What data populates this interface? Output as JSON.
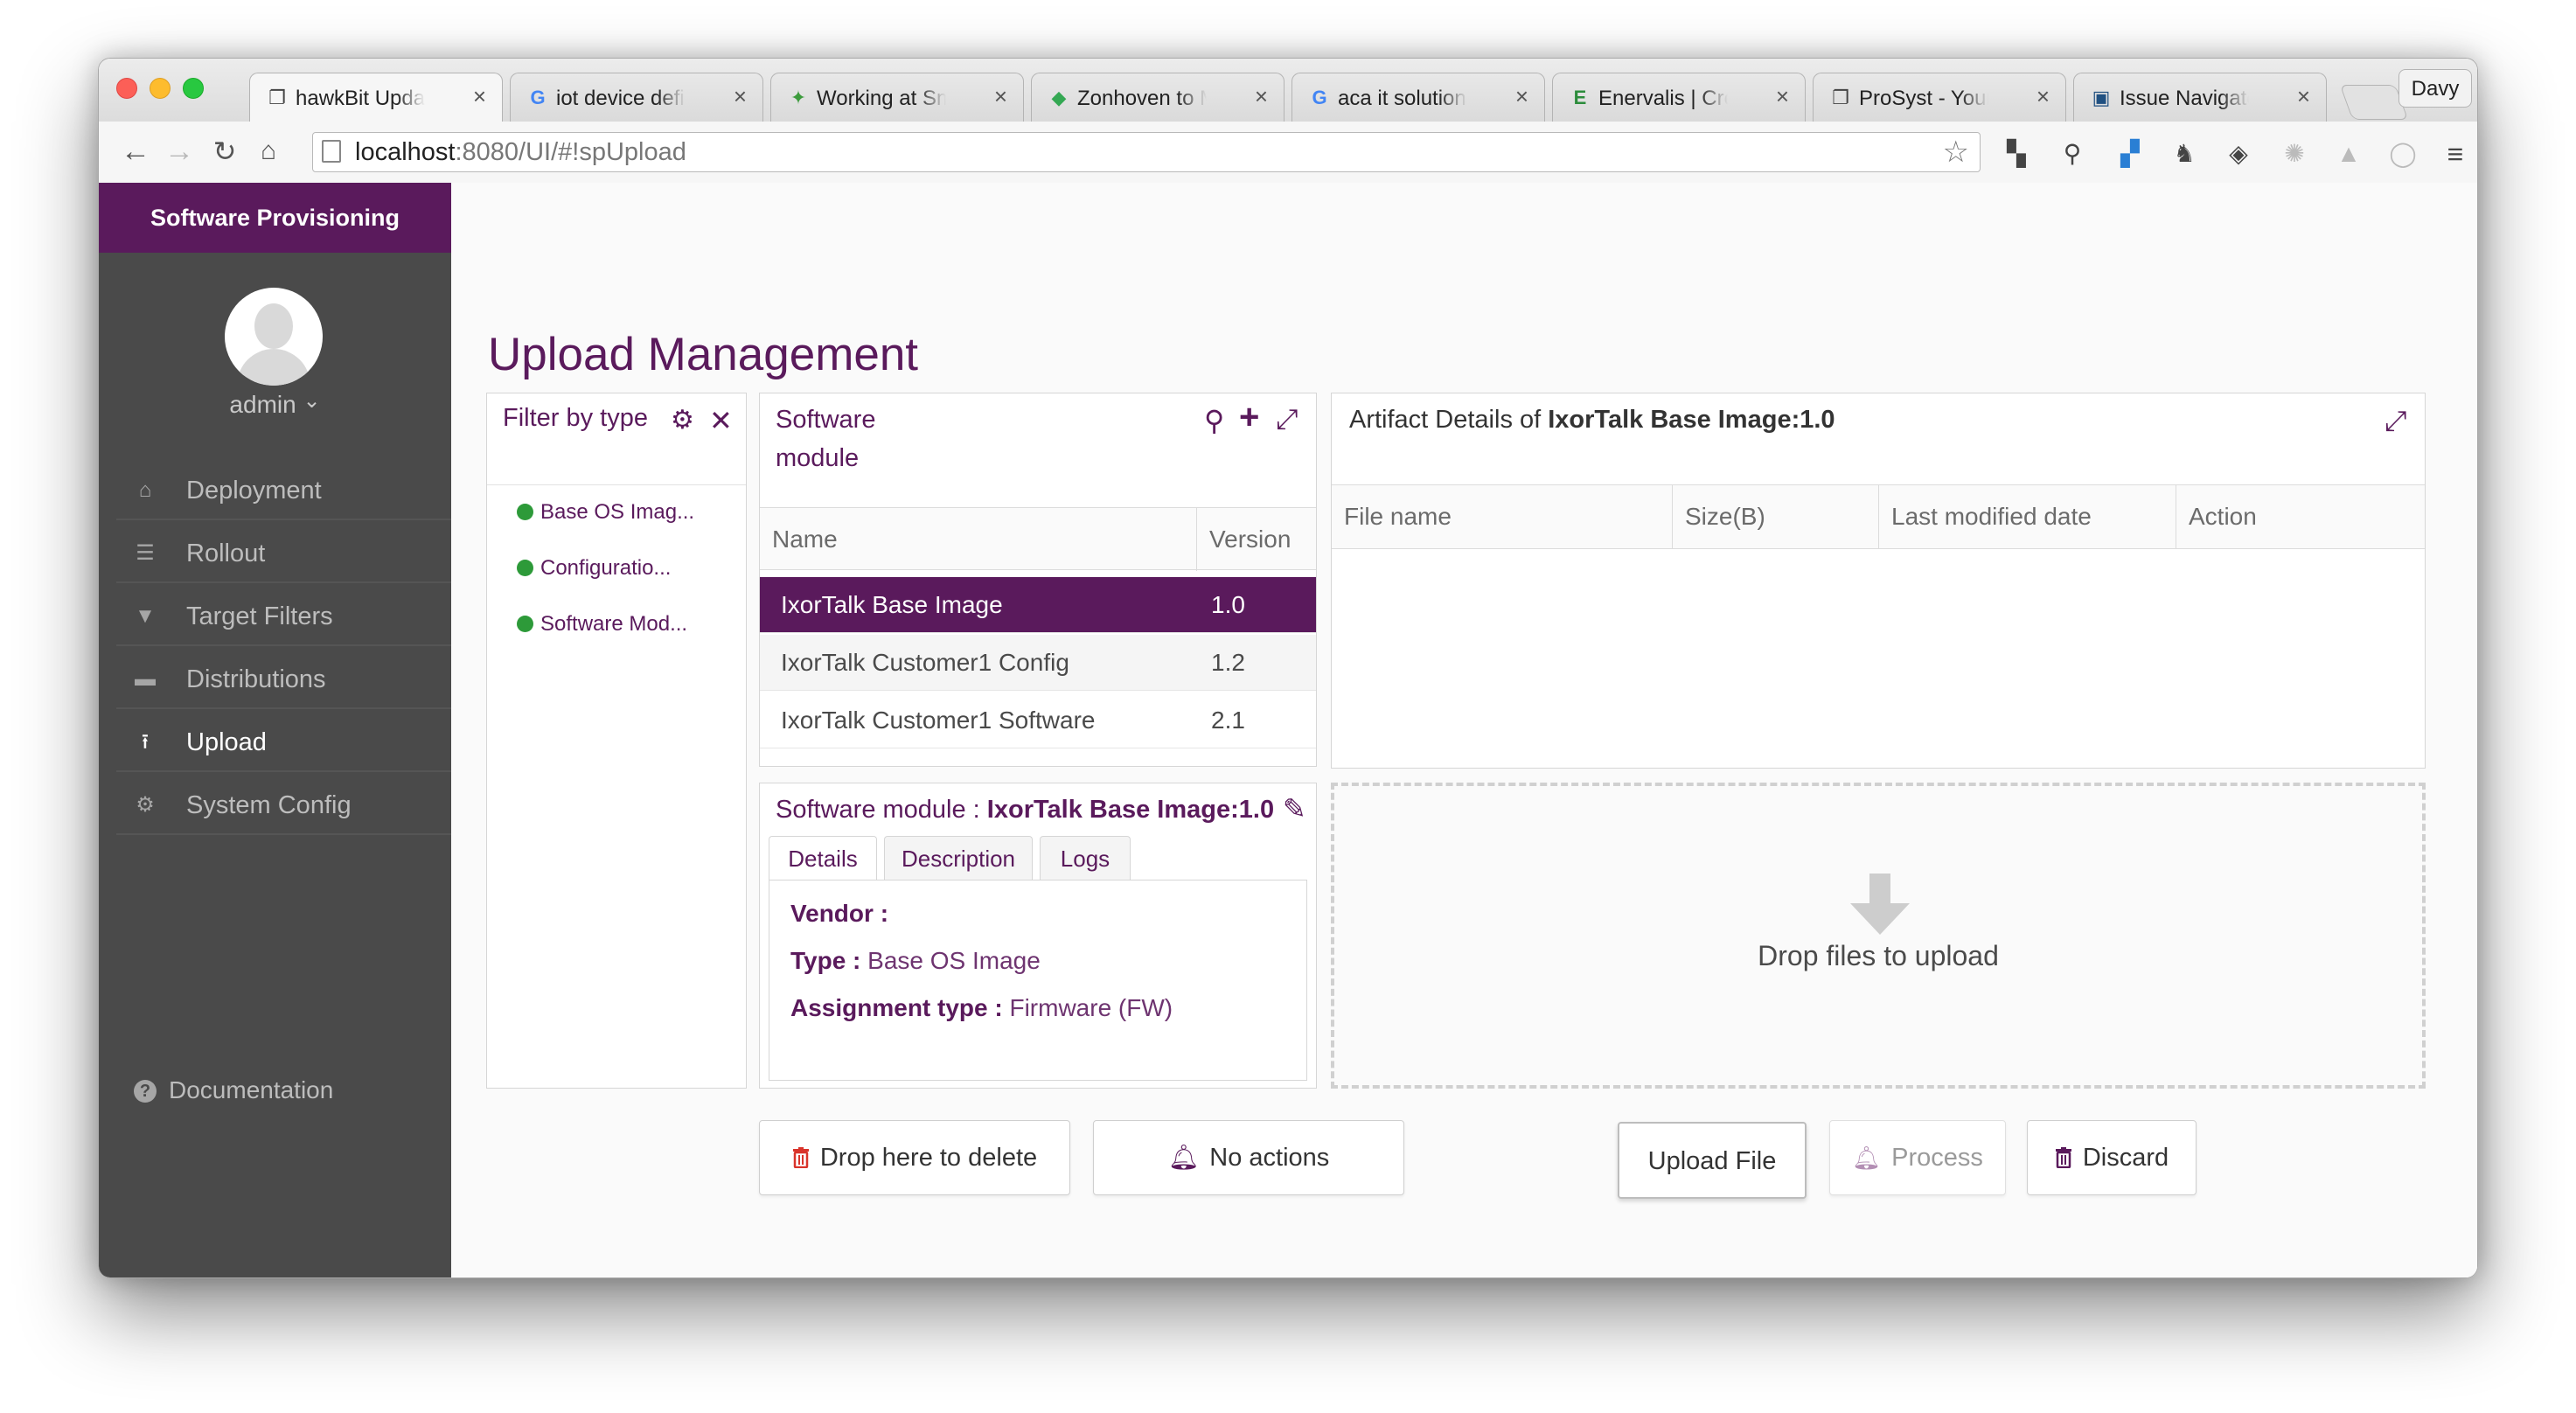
{
  "browser": {
    "tabs": [
      {
        "label": "hawkBit Update S",
        "fav": "❐",
        "color": "#444"
      },
      {
        "label": "iot device definitio",
        "fav": "G",
        "color": "#4285f4"
      },
      {
        "label": "Working at Smartic",
        "fav": "✦",
        "color": "#3c9b3c"
      },
      {
        "label": "Zonhoven to Muns",
        "fav": "◆",
        "color": "#34a853"
      },
      {
        "label": "aca it solutions sn",
        "fav": "G",
        "color": "#4285f4"
      },
      {
        "label": "Enervalis | Creating",
        "fav": "E",
        "color": "#2c8c3c"
      },
      {
        "label": "ProSyst - Your Par",
        "fav": "❐",
        "color": "#444"
      },
      {
        "label": "Issue Navigator - ",
        "fav": "▣",
        "color": "#205081"
      }
    ],
    "tab_close": "×",
    "profile": "Davy",
    "url_host": "localhost",
    "url_rest": ":8080/UI/#!spUpload"
  },
  "sidebar": {
    "header": "Software Provisioning",
    "user": "admin",
    "user_chevron": "⌄",
    "items": [
      {
        "label": "Deployment",
        "icon": "home-icon"
      },
      {
        "label": "Rollout",
        "icon": "list-icon"
      },
      {
        "label": "Target Filters",
        "icon": "filter-icon"
      },
      {
        "label": "Distributions",
        "icon": "briefcase-icon"
      },
      {
        "label": "Upload",
        "icon": "upload-icon"
      },
      {
        "label": "System Config",
        "icon": "gear-icon"
      }
    ],
    "documentation": "Documentation"
  },
  "page": {
    "title": "Upload Management"
  },
  "filter": {
    "title": "Filter by type",
    "types": [
      "Base OS Imag...",
      "Configuratio...",
      "Software Mod..."
    ]
  },
  "software_module": {
    "title_line1": "Software",
    "title_line2": "module",
    "columns": [
      "Name",
      "Version"
    ],
    "rows": [
      {
        "name": "IxorTalk Base Image",
        "version": "1.0"
      },
      {
        "name": "IxorTalk Customer1 Config",
        "version": "1.2"
      },
      {
        "name": "IxorTalk Customer1 Software",
        "version": "2.1"
      }
    ],
    "selected_index": 0
  },
  "details": {
    "heading_prefix": "Software module : ",
    "heading_name": "IxorTalk Base Image:1.0",
    "tabs": [
      "Details",
      "Description",
      "Logs"
    ],
    "vendor_label": "Vendor :",
    "vendor_value": "",
    "type_label": "Type :",
    "type_value": "Base OS Image",
    "assignment_label": "Assignment type :",
    "assignment_value": "Firmware (FW)"
  },
  "artifact": {
    "title_prefix": "Artifact Details of ",
    "title_name": "IxorTalk Base Image:1.0",
    "columns": [
      "File name",
      "Size(B)",
      "Last modified date",
      "Action"
    ],
    "drop_text": "Drop files to upload"
  },
  "buttons": {
    "delete": "Drop here to delete",
    "no_actions": "No actions",
    "upload": "Upload File",
    "process": "Process",
    "discard": "Discard"
  },
  "colors": {
    "brand": "#5a1a5c",
    "sidebar": "#4a4a4a",
    "status_green": "#2d9a39",
    "delete_red": "#d9342b"
  }
}
